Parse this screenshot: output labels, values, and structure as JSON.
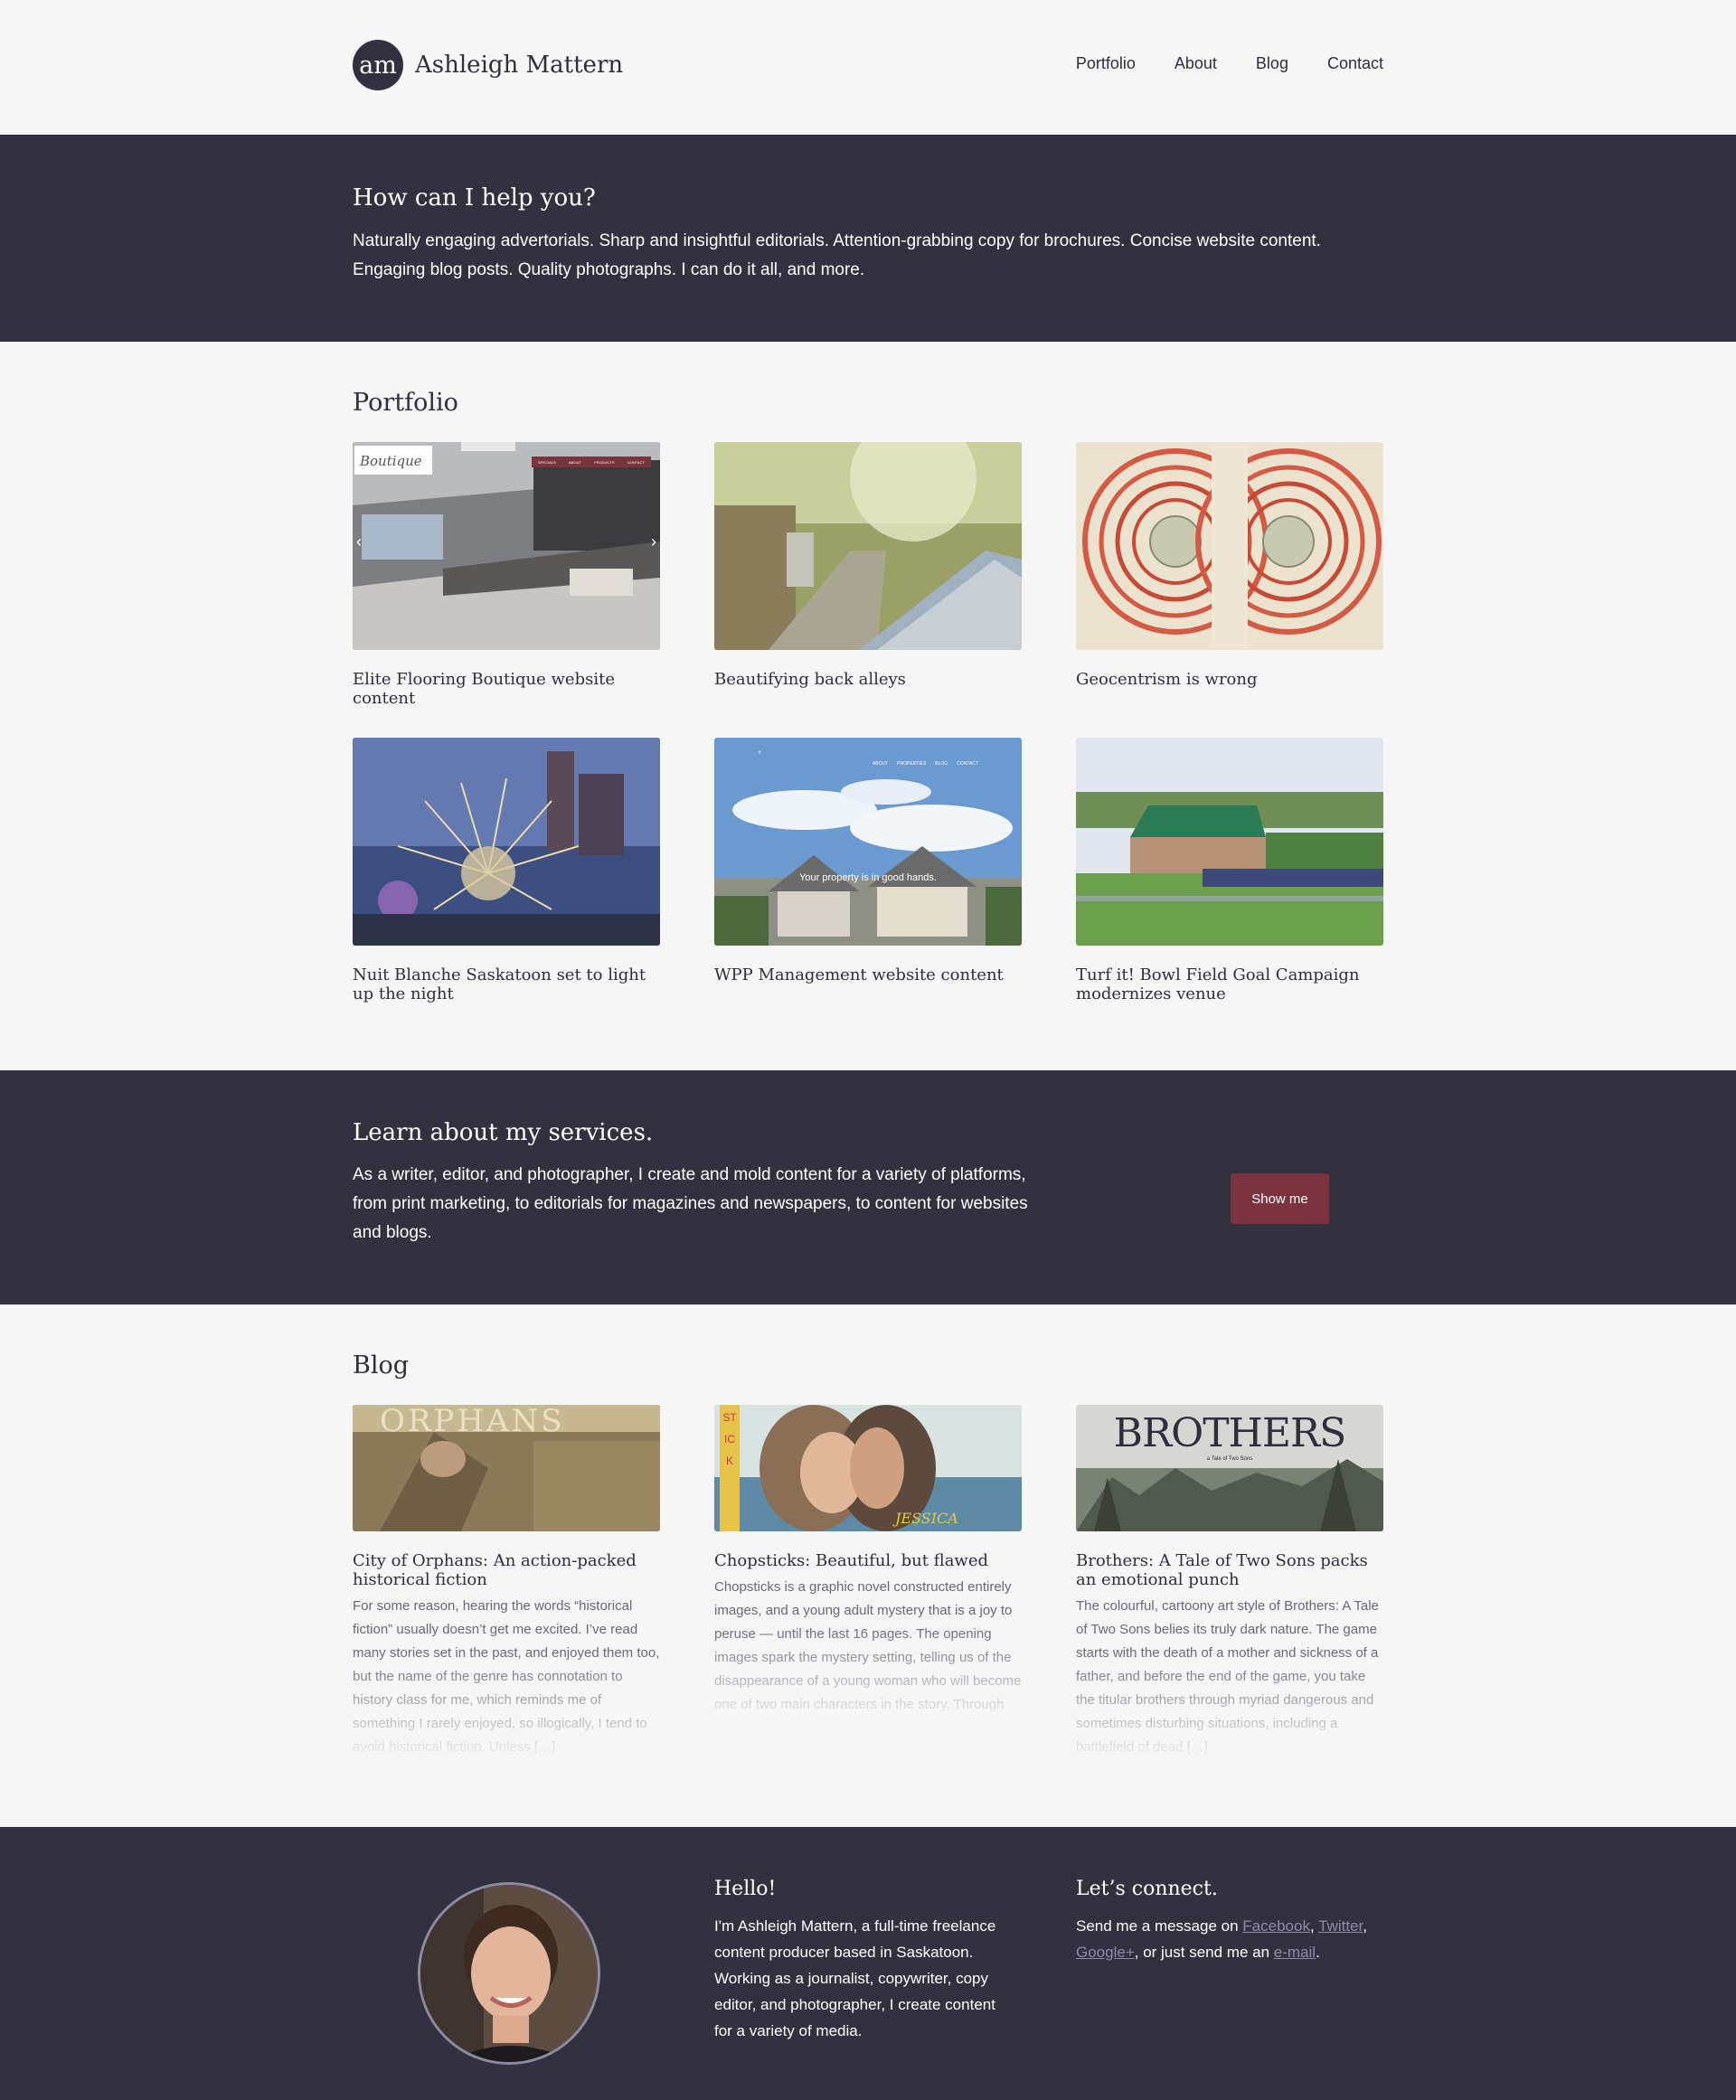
{
  "header": {
    "logo_mark": "am",
    "logo_text": "Ashleigh Mattern",
    "nav": [
      "Portfolio",
      "About",
      "Blog",
      "Contact"
    ]
  },
  "hero": {
    "title": "How can I help you?",
    "text": "Naturally engaging advertorials. Sharp and insightful editorials. Attention-grabbing copy for brochures. Concise website content. Engaging blog posts. Quality photographs. I can do it all, and more."
  },
  "portfolio": {
    "title": "Portfolio",
    "items": [
      {
        "caption": "Elite Flooring Boutique website content",
        "thumb_text": "Boutique",
        "thumb_nav": [
          "SPECIALS",
          "ABOUT",
          "PRODUCTS",
          "CONTACT"
        ],
        "icon": "kitchen-photo"
      },
      {
        "caption": "Beautifying back alleys",
        "icon": "alley-photo"
      },
      {
        "caption": "Geocentrism is wrong",
        "icon": "celestial-chart-photo"
      },
      {
        "caption": "Nuit Blanche Saskatoon set to light up the night",
        "icon": "art-installation-photo"
      },
      {
        "caption": "WPP Management website content",
        "thumb_text": "Your property is in good hands.",
        "thumb_nav": [
          "ABOUT",
          "PROPERTIES",
          "BLOG",
          "CONTACT"
        ],
        "icon": "houses-photo"
      },
      {
        "caption": "Turf it! Bowl Field Goal Campaign modernizes venue",
        "icon": "stadium-photo"
      }
    ]
  },
  "services": {
    "title": "Learn about my services.",
    "text": "As a writer, editor, and photographer, I create and mold content for a variety of platforms, from print marketing, to editorials for magazines and newspapers, to content for websites and blogs.",
    "button": "Show me",
    "button_color": "#7b3340"
  },
  "blog": {
    "title": "Blog",
    "posts": [
      {
        "title": "City of Orphans: An action-packed historical fiction",
        "thumb_text": "ORPHANS",
        "excerpt": "For some reason, hearing the words “historical fiction” usually doesn’t get me excited. I’ve read many stories set in the past, and enjoyed them too, but the name of the genre has connotation to history class for me, which reminds me of something I rarely enjoyed, so illogically, I tend to avoid historical fiction. Unless […]"
      },
      {
        "title": "Chopsticks: Beautiful, but flawed",
        "thumb_text": "STICK",
        "thumb_text2": "JESSICA",
        "excerpt": "Chopsticks is a graphic novel constructed entirely images, and a young adult mystery that is a joy to peruse — until the last 16 pages. The opening images spark the mystery setting, telling us of the disappearance of a young woman who will become one of two main characters in the story. Through one of […]"
      },
      {
        "title": "Brothers: A Tale of Two Sons packs an emotional punch",
        "thumb_text": "BROTHERS",
        "thumb_text2": "a Tale of Two Sons",
        "excerpt": "The colourful, cartoony art style of Brothers: A Tale of Two Sons belies its truly dark nature. The game starts with the death of a mother and sickness of a father, and before the end of the game, you take the titular brothers through myriad dangerous and sometimes disturbing situations, including a battlefield of dead […]"
      }
    ]
  },
  "footer": {
    "hello_title": "Hello!",
    "hello_text": "I'm Ashleigh Mattern, a full-time freelance content producer based in Saskatoon. Working as a journalist, copywriter, copy editor, and photographer, I create content for a variety of media.",
    "connect_title": "Let’s connect.",
    "connect_prefix": "Send me a message on ",
    "links": [
      "Facebook",
      "Twitter",
      "Google+",
      "e-mail"
    ],
    "sep1": ", ",
    "sep2": ",",
    "connect_mid": ", or just send me an ",
    "connect_end": "."
  },
  "colors": {
    "dark": "#33313f",
    "accent": "#7b3340",
    "link": "#8e8ba6"
  }
}
